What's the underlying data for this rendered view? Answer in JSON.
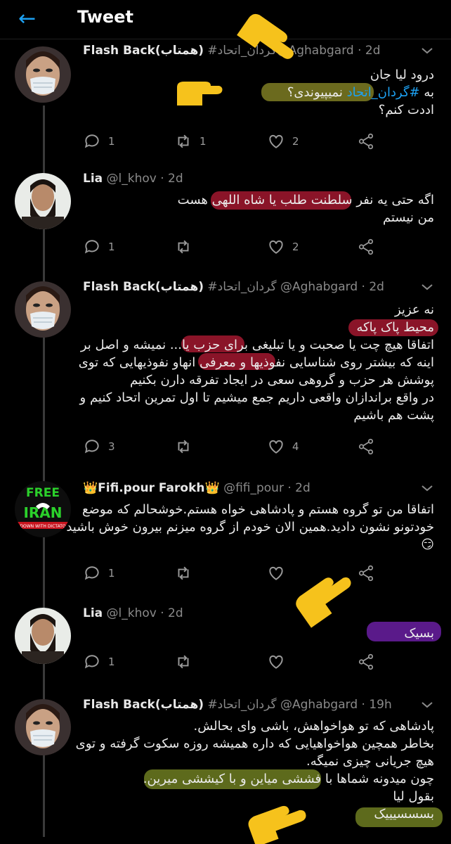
{
  "header": {
    "back_icon": "←",
    "title": "Tweet"
  },
  "colors": {
    "accent": "#1da1f2",
    "background": "#000000",
    "highlight_olive": "#6b6a1e",
    "highlight_red": "#8a1428",
    "highlight_purple": "#5a1a8a"
  },
  "tweets": [
    {
      "name": "Flash Back(همتاب)",
      "handle": "#گردان_اتحاد@Aghabgard · 2d",
      "avatar": "masked-woman-avatar",
      "lines": [
        "درود لیا جان",
        "به #گردان_اتحاد نمیپیوندی؟",
        "اددت کنم؟"
      ],
      "hashtag": "#گردان_اتحاد",
      "replies": "1",
      "retweets": "1",
      "likes": "2"
    },
    {
      "name": "Lia",
      "handle": "@l_khov · 2d",
      "avatar": "bearded-man-avatar",
      "lines": [
        "اگه حتی یه نفر سلطنت طلب یا شاه اللهی هست",
        "من نیستم"
      ],
      "replies": "1",
      "retweets": "",
      "likes": "2"
    },
    {
      "name": "Flash Back(همتاب)",
      "handle": "#گردان_اتحاد @Aghabgard · 2d",
      "avatar": "masked-woman-avatar",
      "lines": [
        "نه عزیز",
        "محیط پاک پاکه",
        "اتفاقا هیچ چت یا صحبت و یا تبلیغی برای حزب یا... نمیشه و اصل بر",
        "اینه که بیشتر روی شناسایی نفوذیها و معرفی انهاو نفوذیهایی که توی",
        "پوشش هر حزب و گروهی سعی در ایجاد تفرقه دارن بکنیم",
        "در واقع براندازان واقعی داریم جمع میشیم تا اول تمرین اتحاد کنیم و",
        "پشت هم باشیم"
      ],
      "replies": "3",
      "retweets": "",
      "likes": "4"
    },
    {
      "name": "👑Fifi.pour Farokh👑",
      "handle": "@fifi_pour · 2d",
      "avatar": "free-iran-avatar",
      "avatar_text_top": "FREE",
      "avatar_text_bottom": "IRAN",
      "avatar_text_strip": "DOWN WITH DICTATO",
      "lines": [
        "اتفاقا من تو گروه هستم و پادشاهی خواه هستم.خوشحالم که موضع",
        "خودتونو نشون دادید.همین الان خودم از گروه میزنم بیرون خوش باشید",
        "😏"
      ],
      "replies": "1",
      "retweets": "",
      "likes": ""
    },
    {
      "name": "Lia",
      "handle": "@l_khov · 2d",
      "avatar": "bearded-man-avatar",
      "lines": [
        "بسیک"
      ],
      "replies": "1",
      "retweets": "",
      "likes": ""
    },
    {
      "name": "Flash Back(همتاب)",
      "handle": "#گردان_اتحاد @Aghabgard · 19h",
      "avatar": "masked-woman-avatar",
      "lines": [
        "پادشاهی که تو هواخواهش، باشی وای بحالش.",
        "بخاطر همچین هواخواهیایی که داره همیشه روزه سکوت گرفته و توی",
        "هیچ جریانی چیزی نمیگه.",
        "چون میدونه شماها با فششی میاین و با کیششی میرین.",
        "بقول لیا",
        "بسسسیییک"
      ],
      "replies": "",
      "retweets": "",
      "likes": ""
    }
  ]
}
